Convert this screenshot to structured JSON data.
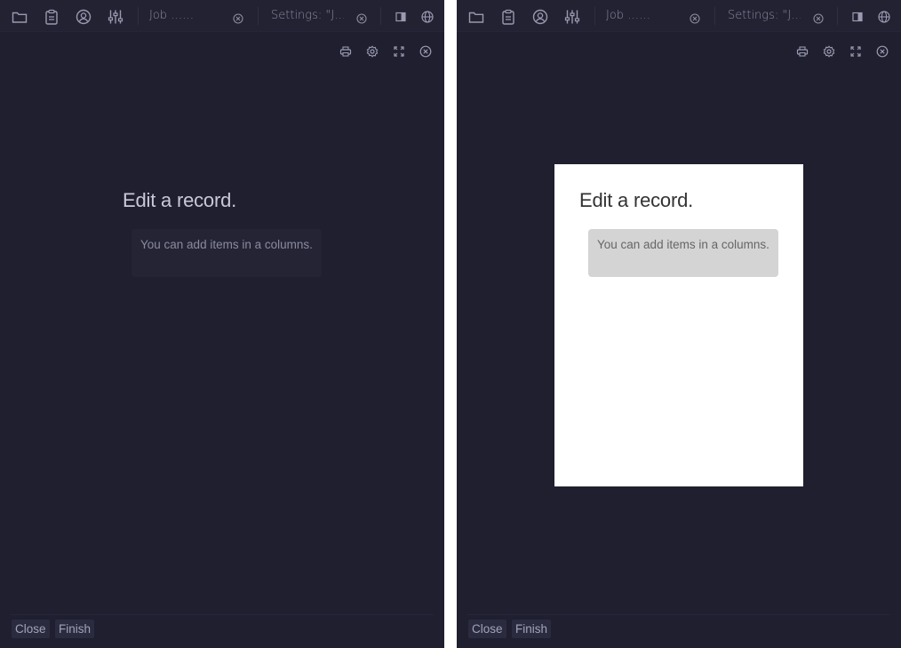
{
  "panes": [
    {
      "id": "left",
      "theme": "dark",
      "tabs": [
        {
          "label": "Job ……"
        },
        {
          "label": "Settings: \"J…"
        }
      ],
      "card": {
        "title": "Edit a record.",
        "note": "You can add items in a columns."
      },
      "footer": {
        "close_label": "Close",
        "finish_label": "Finish"
      }
    },
    {
      "id": "right",
      "theme": "light-card",
      "tabs": [
        {
          "label": "Job ……"
        },
        {
          "label": "Settings: \"J…"
        }
      ],
      "card": {
        "title": "Edit a record.",
        "note": "You can add items in a columns."
      },
      "footer": {
        "close_label": "Close",
        "finish_label": "Finish"
      }
    }
  ],
  "icons": {
    "tabbar": [
      "folder-icon",
      "clipboard-icon",
      "user-circle-icon",
      "sliders-icon",
      "close-icon",
      "close-icon",
      "sidebar-toggle-icon",
      "globe-icon"
    ],
    "toolrow": [
      "printer-icon",
      "gear-icon",
      "expand-icon",
      "close-icon"
    ]
  },
  "colors": {
    "pane_bg": "#1f1f30",
    "tabbar_bg": "#222233",
    "icon": "#9a9ab0",
    "card_light_bg": "#ffffff",
    "note_light_bg": "#d4d4d4",
    "note_dark_bg": "#242435"
  }
}
